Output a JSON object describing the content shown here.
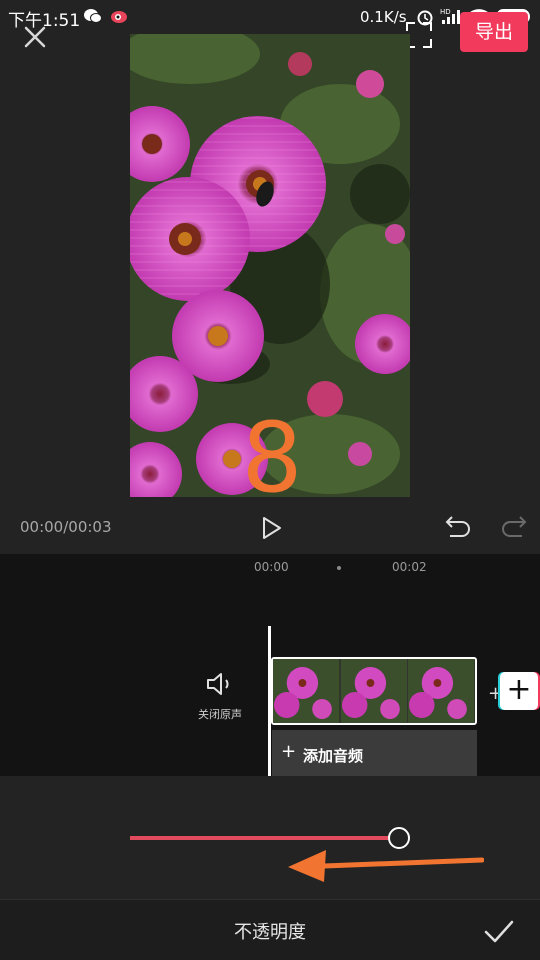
{
  "status_bar": {
    "time": "下午1:51",
    "net_speed": "0.1K/s",
    "battery": "76",
    "icons": [
      "wechat-icon",
      "weibo-icon",
      "alarm-icon",
      "hd-signal-icon",
      "wifi-icon",
      "battery-icon"
    ]
  },
  "top_bar": {
    "close_icon": "close-icon",
    "fullscreen_icon": "fullscreen-icon",
    "export_label": "导出"
  },
  "preview": {
    "description_icon": "video-frame",
    "overlay_number": "8"
  },
  "player": {
    "timecode": "00:00/00:03",
    "play_icon": "play-icon",
    "undo_icon": "undo-icon",
    "redo_icon": "redo-icon"
  },
  "timeline": {
    "ruler": [
      "00:00",
      "00:02"
    ],
    "mute_label": "关闭原声",
    "add_audio_label": "添加音频",
    "add_audio_plus": "+",
    "transition_plus": "+",
    "add_clip_plus": "+"
  },
  "opacity_panel": {
    "title": "不透明度",
    "value_fraction": 0.96,
    "accent_color": "#e24a5e",
    "annotation_arrow_color": "#f27431"
  },
  "colors": {
    "background": "#232323",
    "timeline_bg": "#131313",
    "export_button": "#f23a5c"
  }
}
